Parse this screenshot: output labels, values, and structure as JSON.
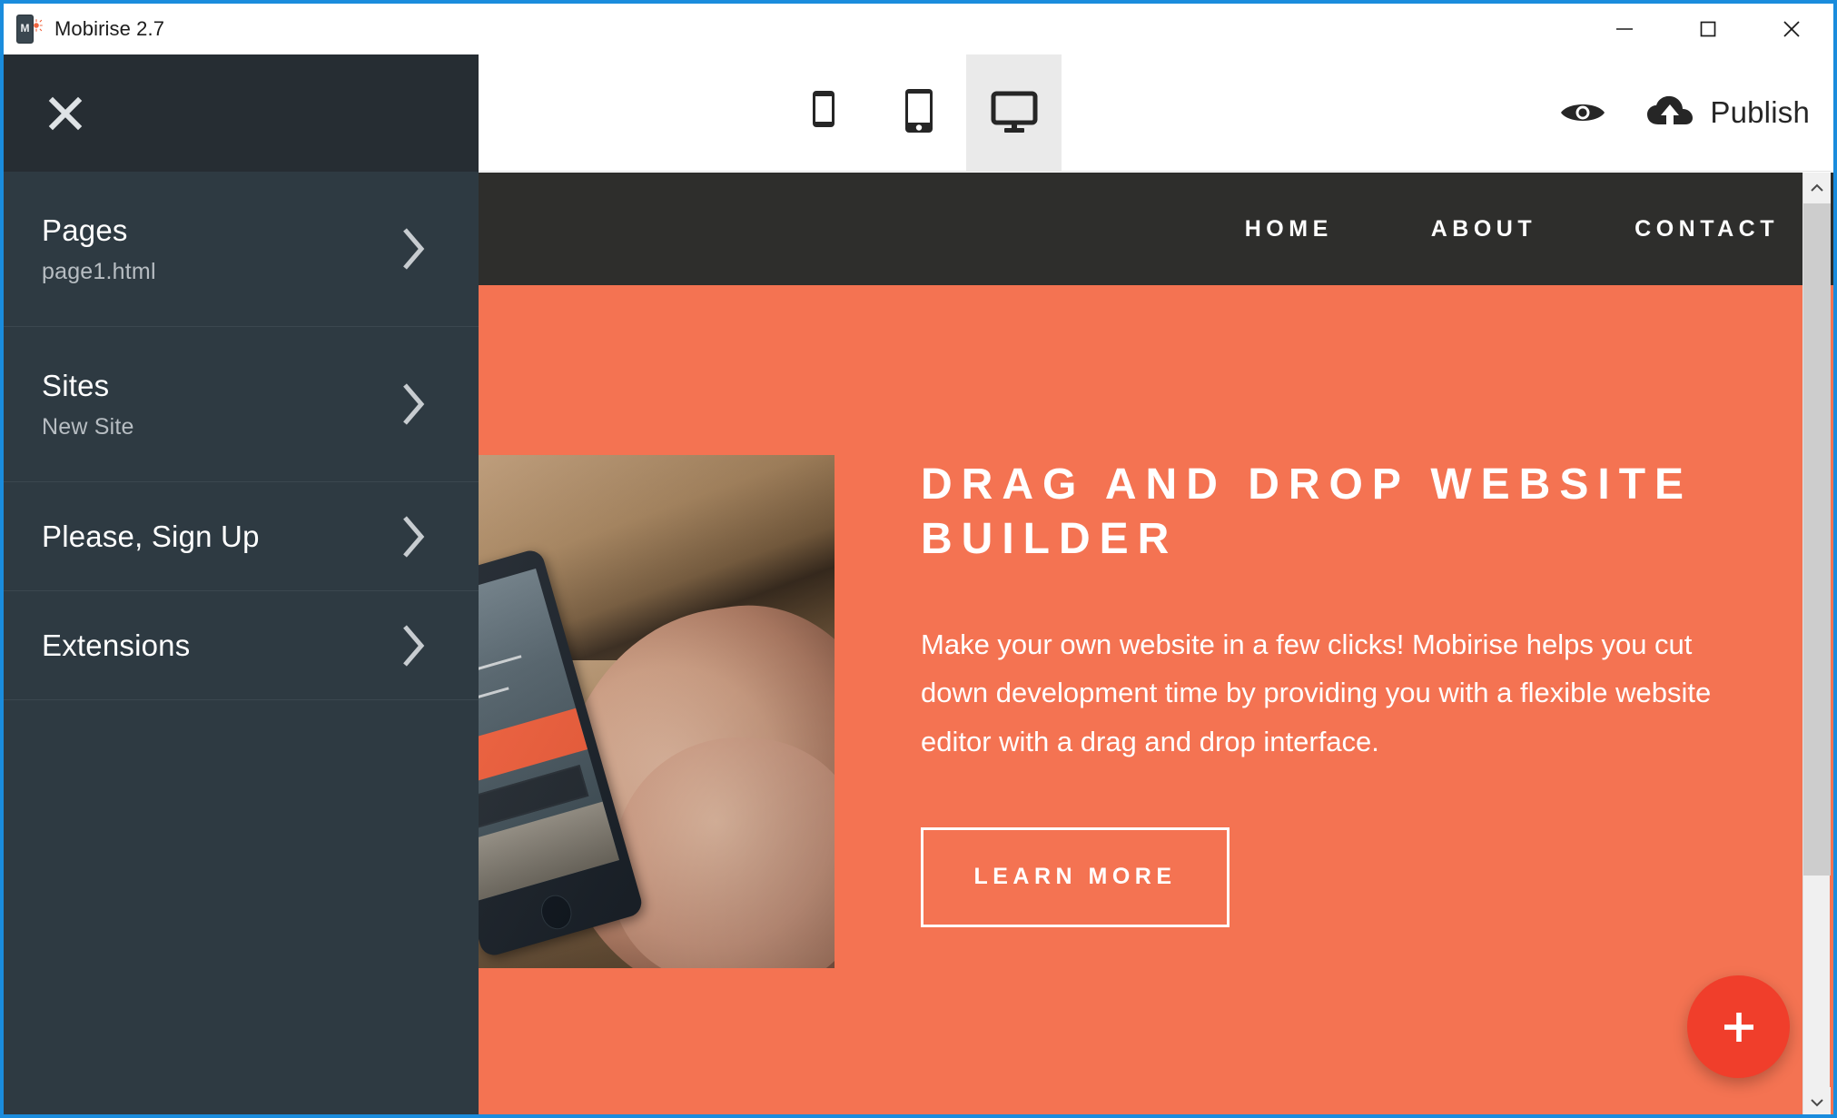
{
  "window": {
    "title": "Mobirise 2.7",
    "app_icon": "mobirise-logo-icon",
    "controls": {
      "minimize": "minimize-icon",
      "maximize": "maximize-icon",
      "close": "close-icon"
    }
  },
  "toolbar": {
    "devices": [
      {
        "name": "mobile",
        "icon": "mobile-phone-icon",
        "active": false
      },
      {
        "name": "tablet",
        "icon": "tablet-icon",
        "active": false
      },
      {
        "name": "desktop",
        "icon": "desktop-monitor-icon",
        "active": true
      }
    ],
    "preview_icon": "eye-icon",
    "publish_icon": "cloud-upload-icon",
    "publish_label": "Publish"
  },
  "sidebar": {
    "close_icon": "close-x-icon",
    "items": [
      {
        "title": "Pages",
        "subtitle": "page1.html",
        "chevron": "chevron-right-icon"
      },
      {
        "title": "Sites",
        "subtitle": "New Site",
        "chevron": "chevron-right-icon"
      },
      {
        "title": "Please, Sign Up",
        "subtitle": "",
        "chevron": "chevron-right-icon"
      },
      {
        "title": "Extensions",
        "subtitle": "",
        "chevron": "chevron-right-icon"
      }
    ]
  },
  "preview": {
    "site_nav": {
      "links": [
        "HOME",
        "ABOUT",
        "CONTACT"
      ]
    },
    "hero": {
      "image_alt": "hand-holding-smartphone-on-wooden-table",
      "title": "DRAG AND DROP WEBSITE BUILDER",
      "body": "Make your own website in a few clicks! Mobirise helps you cut down development time by providing you with a flexible website editor with a drag and drop interface.",
      "cta_label": "LEARN MORE"
    },
    "add_block_icon": "plus-icon",
    "scrollbar": {
      "up_arrow": "chevron-up-icon",
      "down_arrow": "chevron-down-icon"
    }
  },
  "colors": {
    "accent_orange": "#F47352",
    "add_button_red": "#F03E2B",
    "sidebar_bg": "#2E3A42",
    "sidebar_header_bg": "#262D33",
    "site_nav_bg": "#2E2E2C",
    "window_border_blue": "#1A8CDD"
  }
}
